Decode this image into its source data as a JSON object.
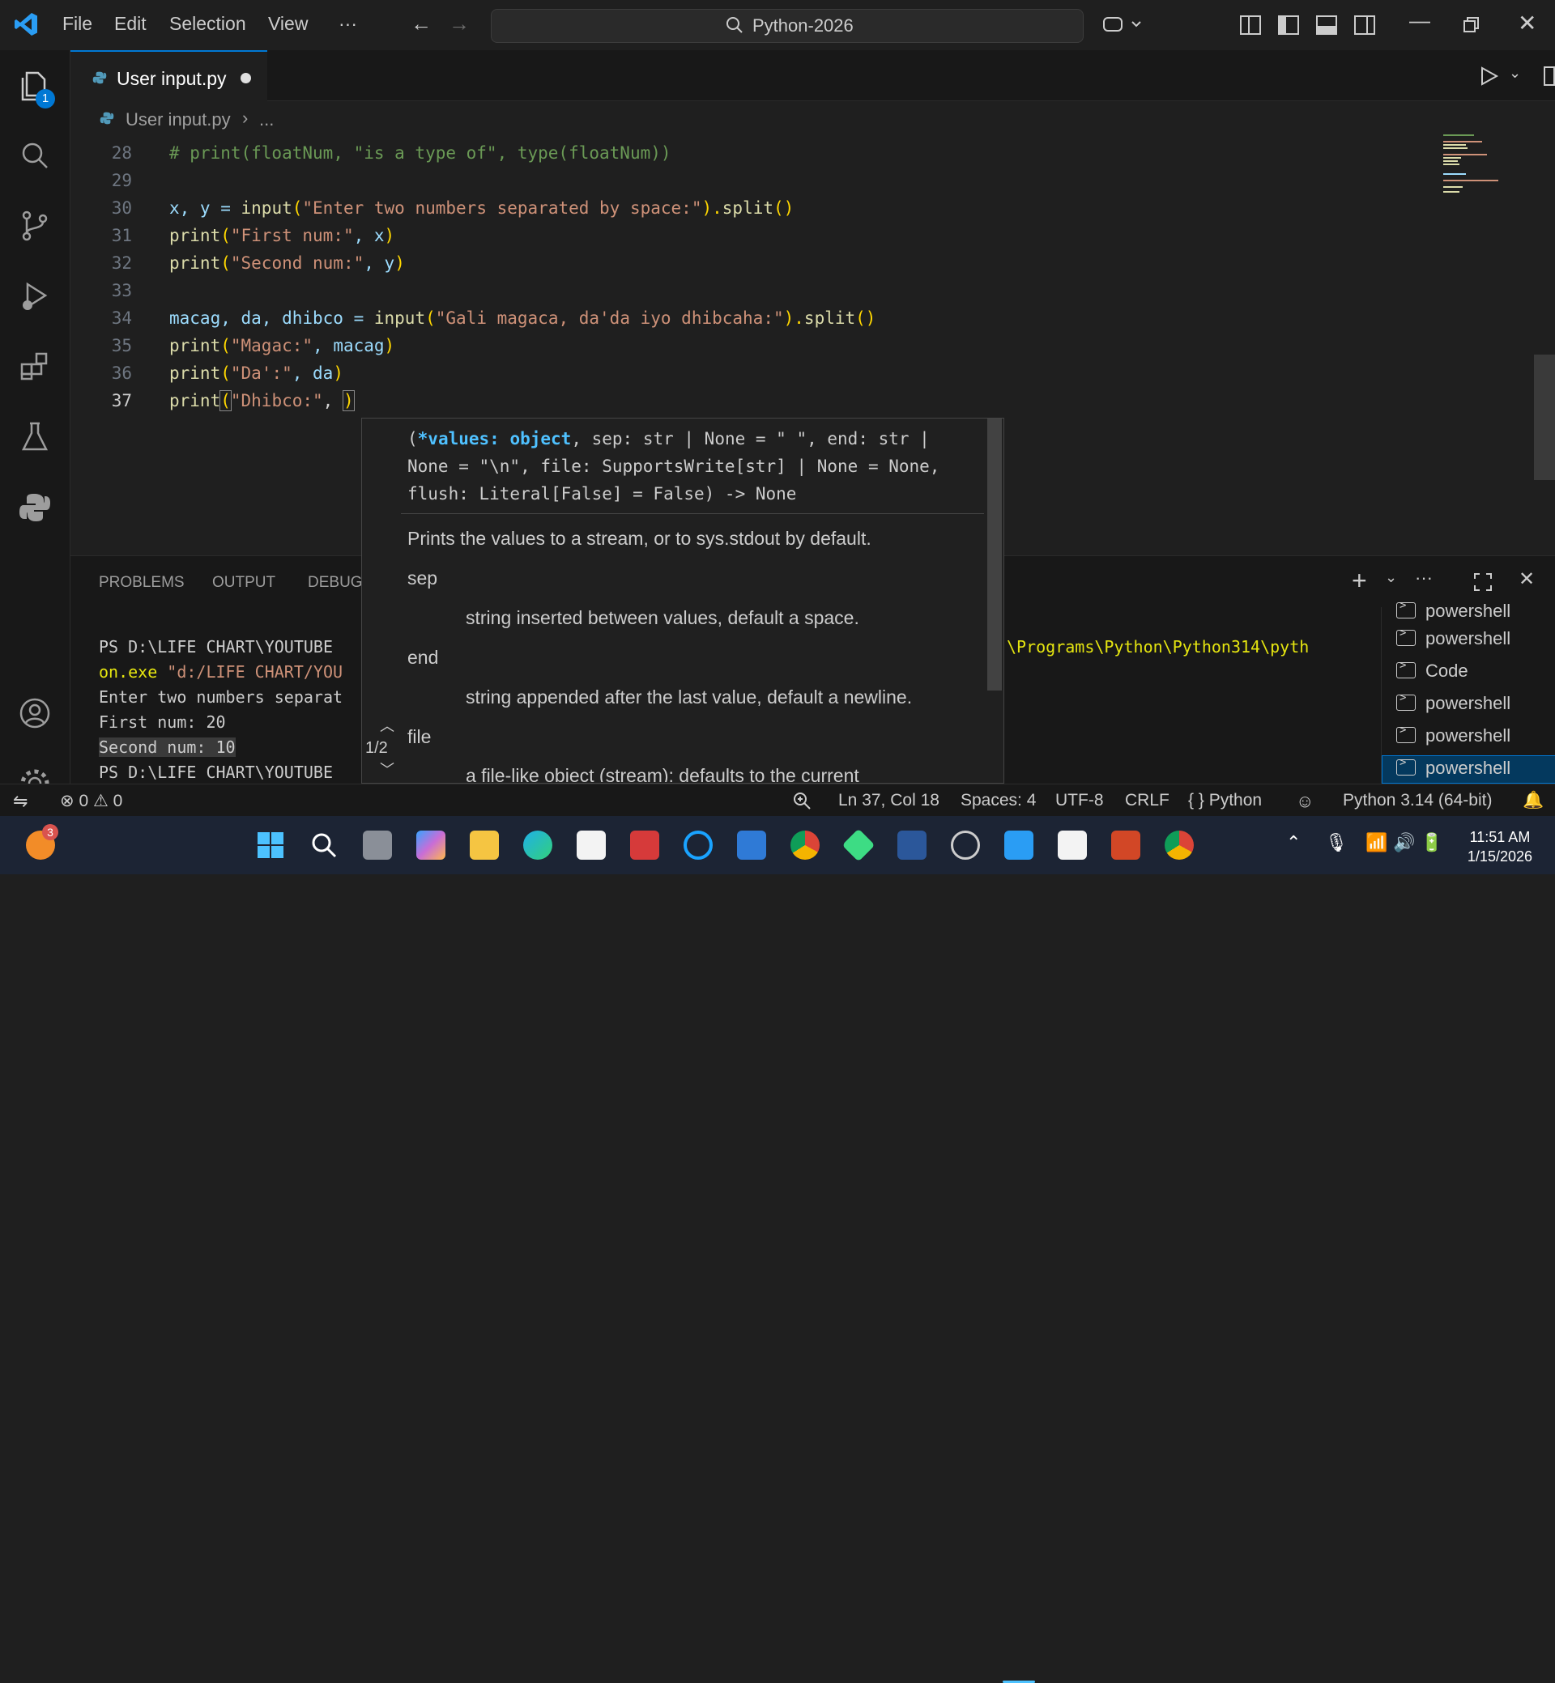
{
  "titlebar": {
    "menu": [
      "File",
      "Edit",
      "Selection",
      "View",
      "···"
    ],
    "search": "Python-2026"
  },
  "activity": {
    "explorer_badge": "1"
  },
  "tab": {
    "label": "User input.py"
  },
  "breadcrumb": {
    "file": "User input.py",
    "rest": "..."
  },
  "editor": {
    "lines": [
      {
        "n": "28"
      },
      {
        "n": "29"
      },
      {
        "n": "30"
      },
      {
        "n": "31"
      },
      {
        "n": "32"
      },
      {
        "n": "33"
      },
      {
        "n": "34"
      },
      {
        "n": "35"
      },
      {
        "n": "36"
      },
      {
        "n": "37"
      }
    ],
    "code": {
      "l28": "# print(floatNum, \"is a type of\", type(floatNum))",
      "l30a": "x, y = ",
      "l30b": "input",
      "l30c": "(",
      "l30d": "\"Enter two numbers separated by space:\"",
      "l30e": ").",
      "l30f": "split",
      "l30g": "()",
      "l31a": "print",
      "l31b": "(",
      "l31c": "\"First num:\"",
      "l31d": ", x",
      "l31e": ")",
      "l32a": "print",
      "l32b": "(",
      "l32c": "\"Second num:\"",
      "l32d": ", y",
      "l32e": ")",
      "l34a": "macag, da, dhibco = ",
      "l34b": "input",
      "l34c": "(",
      "l34d": "\"Gali magaca, da'da iyo dhibcaha:\"",
      "l34e": ").",
      "l34f": "split",
      "l34g": "()",
      "l35a": "print",
      "l35b": "(",
      "l35c": "\"Magac:\"",
      "l35d": ", macag",
      "l35e": ")",
      "l36a": "print",
      "l36b": "(",
      "l36c": "\"Da':\"",
      "l36d": ", da",
      "l36e": ")",
      "l37a": "print",
      "l37b": "(",
      "l37c": "\"Dhibco:\"",
      "l37d": ", ",
      "l37e": ")"
    }
  },
  "hover": {
    "sig1a": "(",
    "sig1b": "*values: object",
    "sig1c": ", sep: str | None = \" \", end: str |",
    "sig2": "None = \"\\n\", file: SupportsWrite[str] | None = None,",
    "sig3": "flush: Literal[False] = False) -> None",
    "desc": "Prints the values to a stream, or to sys.stdout by default.",
    "p1": "sep",
    "p1d": "string inserted between values, default a space.",
    "p2": "end",
    "p2d": "string appended after the last value, default a newline.",
    "p3": "file",
    "p3d": "a file-like object (stream); defaults to the current",
    "count": "1/2"
  },
  "panel": {
    "tabs": [
      "PROBLEMS",
      "OUTPUT",
      "DEBUG"
    ],
    "term": [
      "PS D:\\LIFE CHART\\YOUTUBE",
      "on.exe ",
      "Enter two numbers separat",
      "First num: 20",
      "Second num: 10",
      "PS D:\\LIFE CHART\\YOUTUBE"
    ],
    "term_path": "\"d:/LIFE CHART/YOU",
    "term_right": "\\Programs\\Python\\Python314\\pyth",
    "terminals": [
      "powershell",
      "powershell",
      "Code",
      "powershell",
      "powershell",
      "powershell"
    ]
  },
  "status": {
    "errors": "0",
    "warnings": "0",
    "position": "Ln 37, Col 18",
    "spaces": "Spaces: 4",
    "encoding": "UTF-8",
    "eol": "CRLF",
    "lang": "Python",
    "interpreter": "Python 3.14 (64-bit)"
  },
  "taskbar": {
    "time": "11:51 AM",
    "date": "1/15/2026",
    "notif_badge": "3"
  },
  "colors": {
    "accent": "#0078d4",
    "bg": "#1f1f1f",
    "taskbar": "#1c2434"
  }
}
